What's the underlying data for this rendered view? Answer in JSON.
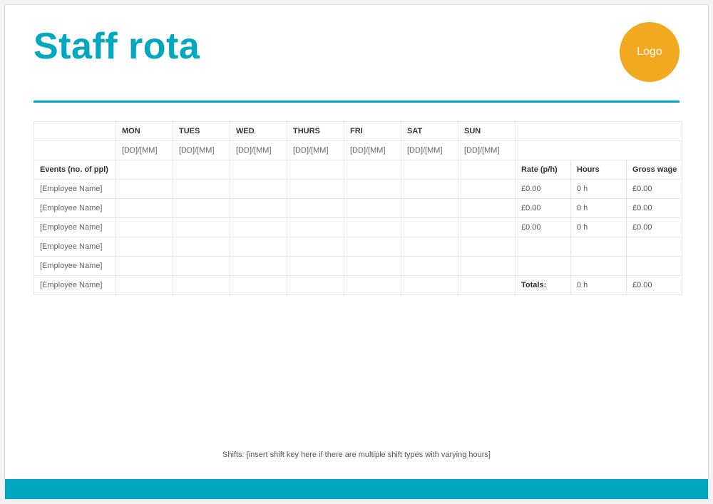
{
  "header": {
    "title": "Staff rota",
    "logo_text": "Logo"
  },
  "days": {
    "mon": {
      "label": "MON",
      "date": "[DD]/[MM]"
    },
    "tues": {
      "label": "TUES",
      "date": "[DD]/[MM]"
    },
    "wed": {
      "label": "WED",
      "date": "[DD]/[MM]"
    },
    "thurs": {
      "label": "THURS",
      "date": "[DD]/[MM]"
    },
    "fri": {
      "label": "FRI",
      "date": "[DD]/[MM]"
    },
    "sat": {
      "label": "SAT",
      "date": "[DD]/[MM]"
    },
    "sun": {
      "label": "SUN",
      "date": "[DD]/[MM]"
    }
  },
  "columns": {
    "events": "Events (no. of ppl)",
    "rate": "Rate (p/h)",
    "hours": "Hours",
    "gross": "Gross wage"
  },
  "employees": [
    {
      "name": "[Employee Name]",
      "rate": "£0.00",
      "hours": "0 h",
      "gross": "£0.00"
    },
    {
      "name": "[Employee Name]",
      "rate": "£0.00",
      "hours": "0 h",
      "gross": "£0.00"
    },
    {
      "name": "[Employee Name]",
      "rate": "£0.00",
      "hours": "0 h",
      "gross": "£0.00"
    },
    {
      "name": "[Employee Name]",
      "rate": "",
      "hours": "",
      "gross": ""
    },
    {
      "name": "[Employee Name]",
      "rate": "",
      "hours": "",
      "gross": ""
    },
    {
      "name": "[Employee Name]",
      "rate": "",
      "hours": "",
      "gross": ""
    }
  ],
  "totals": {
    "label": "Totals:",
    "hours": "0 h",
    "gross": "£0.00"
  },
  "footer": {
    "shifts_note": "Shifts: [insert shift key here if there are multiple shift types with varying hours]"
  }
}
